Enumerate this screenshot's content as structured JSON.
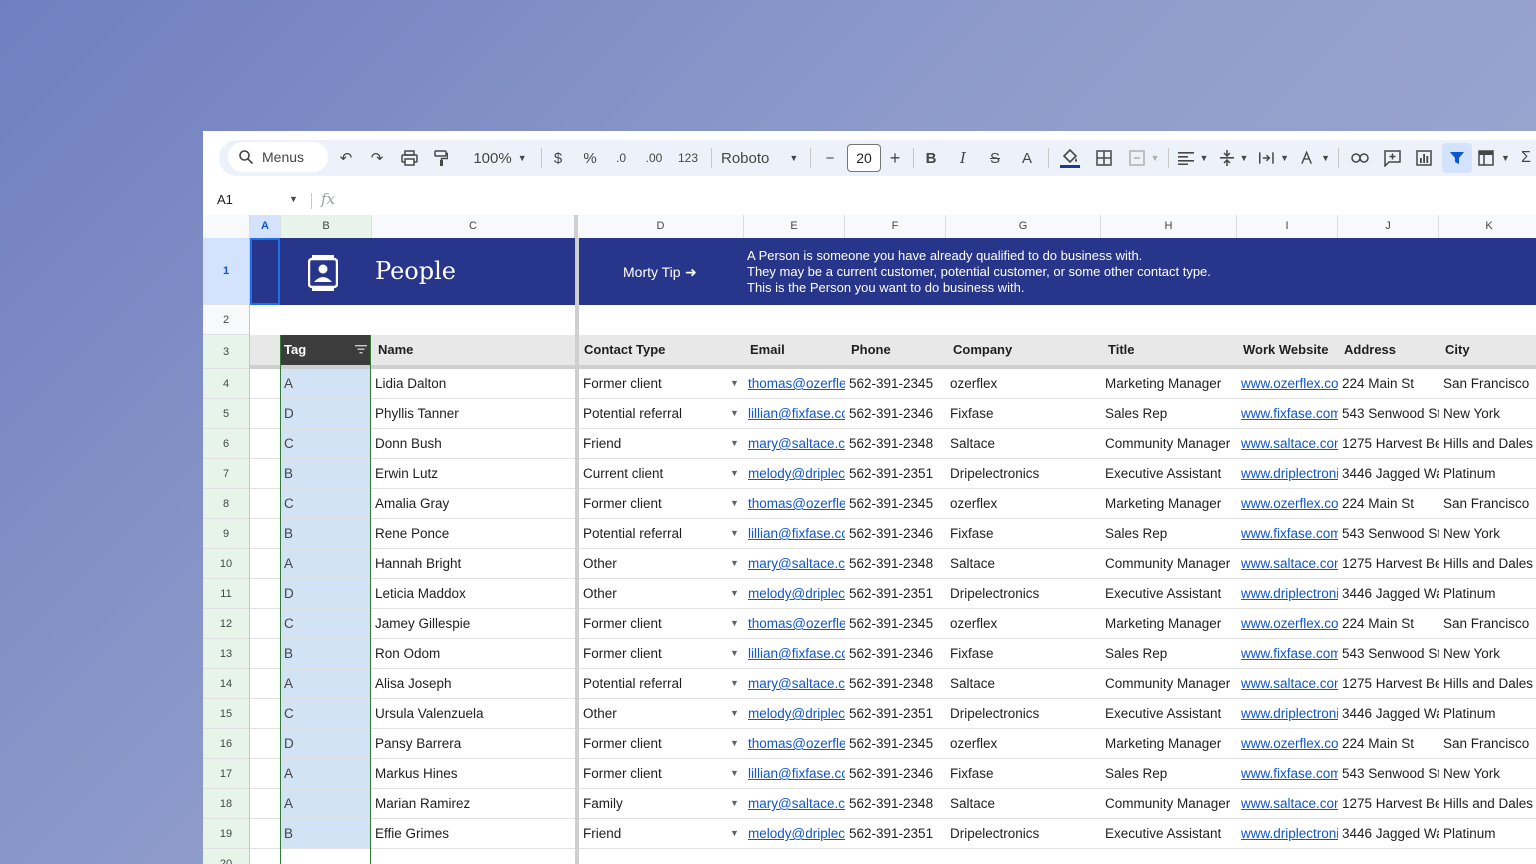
{
  "toolbar": {
    "menus_label": "Menus",
    "zoom": "100%",
    "currency": "$",
    "percent": "%",
    "dec_decrease": ".0",
    "dec_increase": ".00",
    "number_format": "123",
    "font": "Roboto",
    "font_size": "20",
    "minus": "−",
    "plus": "+",
    "bold": "B",
    "italic": "I",
    "strike": "S",
    "text_color": "A"
  },
  "formula_bar": {
    "name_box": "A1",
    "fx": "fx"
  },
  "columns": [
    "A",
    "B",
    "C",
    "D",
    "E",
    "F",
    "G",
    "H",
    "I",
    "J",
    "K"
  ],
  "rows_numbers": [
    "1",
    "2",
    "3",
    "4",
    "5",
    "6",
    "7",
    "8",
    "9",
    "10",
    "11",
    "12",
    "13",
    "14",
    "15",
    "16",
    "17",
    "18",
    "19",
    "20"
  ],
  "banner": {
    "title": "People",
    "tip": "Morty Tip",
    "arrow": "➜",
    "line1": "A Person is someone you have already qualified to do business with.",
    "line2": "They may be a current customer, potential customer, or some other contact type.",
    "line3": "This is the Person you want to do business with."
  },
  "headers": {
    "tag": "Tag",
    "name": "Name",
    "contact_type": "Contact Type",
    "email": "Email",
    "phone": "Phone",
    "company": "Company",
    "title": "Title",
    "work_website": "Work Website",
    "address": "Address",
    "city": "City"
  },
  "rows": [
    {
      "tag": "A",
      "name": "Lidia Dalton",
      "type": "Former client",
      "email": "thomas@ozerfle",
      "phone": "562-391-2345",
      "company": "ozerflex",
      "title": "Marketing Manager",
      "web": "www.ozerflex.co",
      "address": "224 Main St",
      "city": "San Francisco"
    },
    {
      "tag": "D",
      "name": "Phyllis Tanner",
      "type": "Potential referral",
      "email": "lillian@fixfase.cc",
      "phone": "562-391-2346",
      "company": "Fixfase",
      "title": "Sales Rep",
      "web": "www.fixfase.com",
      "address": "543 Senwood St",
      "city": "New York"
    },
    {
      "tag": "C",
      "name": "Donn Bush",
      "type": "Friend",
      "email": "mary@saltace.c",
      "phone": "562-391-2348",
      "company": "Saltace",
      "title": "Community Manager",
      "web": "www.saltace.com",
      "address": "1275 Harvest Be",
      "city": "Hills and Dales"
    },
    {
      "tag": "B",
      "name": "Erwin Lutz",
      "type": "Current client",
      "email": "melody@driplec",
      "phone": "562-391-2351",
      "company": "Dripelectronics",
      "title": "Executive Assistant",
      "web": "www.driplectroni",
      "address": "3446 Jagged Wa",
      "city": "Platinum"
    },
    {
      "tag": "C",
      "name": "Amalia Gray",
      "type": "Former client",
      "email": "thomas@ozerfle",
      "phone": "562-391-2345",
      "company": "ozerflex",
      "title": "Marketing Manager",
      "web": "www.ozerflex.co",
      "address": "224 Main St",
      "city": "San Francisco"
    },
    {
      "tag": "B",
      "name": "Rene Ponce",
      "type": "Potential referral",
      "email": "lillian@fixfase.cc",
      "phone": "562-391-2346",
      "company": "Fixfase",
      "title": "Sales Rep",
      "web": "www.fixfase.com",
      "address": "543 Senwood St",
      "city": "New York"
    },
    {
      "tag": "A",
      "name": "Hannah Bright",
      "type": "Other",
      "email": "mary@saltace.c",
      "phone": "562-391-2348",
      "company": "Saltace",
      "title": "Community Manager",
      "web": "www.saltace.com",
      "address": "1275 Harvest Be",
      "city": "Hills and Dales"
    },
    {
      "tag": "D",
      "name": "Leticia Maddox",
      "type": "Other",
      "email": "melody@driplec",
      "phone": "562-391-2351",
      "company": "Dripelectronics",
      "title": "Executive Assistant",
      "web": "www.driplectroni",
      "address": "3446 Jagged Wa",
      "city": "Platinum"
    },
    {
      "tag": "C",
      "name": "Jamey Gillespie",
      "type": "Former client",
      "email": "thomas@ozerfle",
      "phone": "562-391-2345",
      "company": "ozerflex",
      "title": "Marketing Manager",
      "web": "www.ozerflex.co",
      "address": "224 Main St",
      "city": "San Francisco"
    },
    {
      "tag": "B",
      "name": "Ron Odom",
      "type": "Former client",
      "email": "lillian@fixfase.cc",
      "phone": "562-391-2346",
      "company": "Fixfase",
      "title": "Sales Rep",
      "web": "www.fixfase.com",
      "address": "543 Senwood St",
      "city": "New York"
    },
    {
      "tag": "A",
      "name": "Alisa Joseph",
      "type": "Potential referral",
      "email": "mary@saltace.c",
      "phone": "562-391-2348",
      "company": "Saltace",
      "title": "Community Manager",
      "web": "www.saltace.com",
      "address": "1275 Harvest Be",
      "city": "Hills and Dales"
    },
    {
      "tag": "C",
      "name": "Ursula Valenzuela",
      "type": "Other",
      "email": "melody@driplec",
      "phone": "562-391-2351",
      "company": "Dripelectronics",
      "title": "Executive Assistant",
      "web": "www.driplectroni",
      "address": "3446 Jagged Wa",
      "city": "Platinum"
    },
    {
      "tag": "D",
      "name": "Pansy Barrera",
      "type": "Former client",
      "email": "thomas@ozerfle",
      "phone": "562-391-2345",
      "company": "ozerflex",
      "title": "Marketing Manager",
      "web": "www.ozerflex.co",
      "address": "224 Main St",
      "city": "San Francisco"
    },
    {
      "tag": "A",
      "name": "Markus Hines",
      "type": "Former client",
      "email": "lillian@fixfase.cc",
      "phone": "562-391-2346",
      "company": "Fixfase",
      "title": "Sales Rep",
      "web": "www.fixfase.com",
      "address": "543 Senwood St",
      "city": "New York"
    },
    {
      "tag": "A",
      "name": "Marian Ramirez",
      "type": "Family",
      "email": "mary@saltace.c",
      "phone": "562-391-2348",
      "company": "Saltace",
      "title": "Community Manager",
      "web": "www.saltace.com",
      "address": "1275 Harvest Be",
      "city": "Hills and Dales"
    },
    {
      "tag": "B",
      "name": "Effie Grimes",
      "type": "Friend",
      "email": "melody@driplec",
      "phone": "562-391-2351",
      "company": "Dripelectronics",
      "title": "Executive Assistant",
      "web": "www.driplectroni",
      "address": "3446 Jagged Wa",
      "city": "Platinum"
    }
  ],
  "colors": {
    "banner": "#27358a",
    "tag_fill": "#d2e3f6",
    "link": "#1155cc",
    "header_fill": "#e8e8e8"
  }
}
